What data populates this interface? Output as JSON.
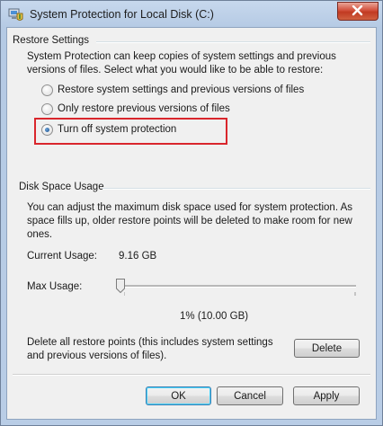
{
  "window": {
    "title": "System Protection for Local Disk (C:)",
    "icon": "system-protection-icon",
    "close_icon": "close-icon",
    "close_color": "#c7432b"
  },
  "restore_settings": {
    "heading": "Restore Settings",
    "description_line1": "System Protection can keep copies of system settings and previous",
    "description_line2": "versions of files. Select what you would like to be able to restore:",
    "options": [
      {
        "label": "Restore system settings and previous versions of files",
        "checked": false
      },
      {
        "label": "Only restore previous versions of files",
        "checked": false
      },
      {
        "label": "Turn off system protection",
        "checked": true
      }
    ],
    "highlight_color": "#d9262c"
  },
  "disk_space": {
    "heading": "Disk Space Usage",
    "description_line1": "You can adjust the maximum disk space used for system protection. As",
    "description_line2": "space fills up, older restore points will be deleted to make room for new",
    "description_line3": "ones.",
    "current_usage_label": "Current Usage:",
    "current_usage_value": "9.16 GB",
    "max_usage_label": "Max Usage:",
    "max_usage_percent": 1,
    "max_usage_text": "1% (10.00 GB)",
    "delete_line1": "Delete all restore points (this includes system settings",
    "delete_line2": "and previous versions of files).",
    "delete_button": "Delete"
  },
  "footer": {
    "ok": "OK",
    "cancel": "Cancel",
    "apply": "Apply"
  }
}
